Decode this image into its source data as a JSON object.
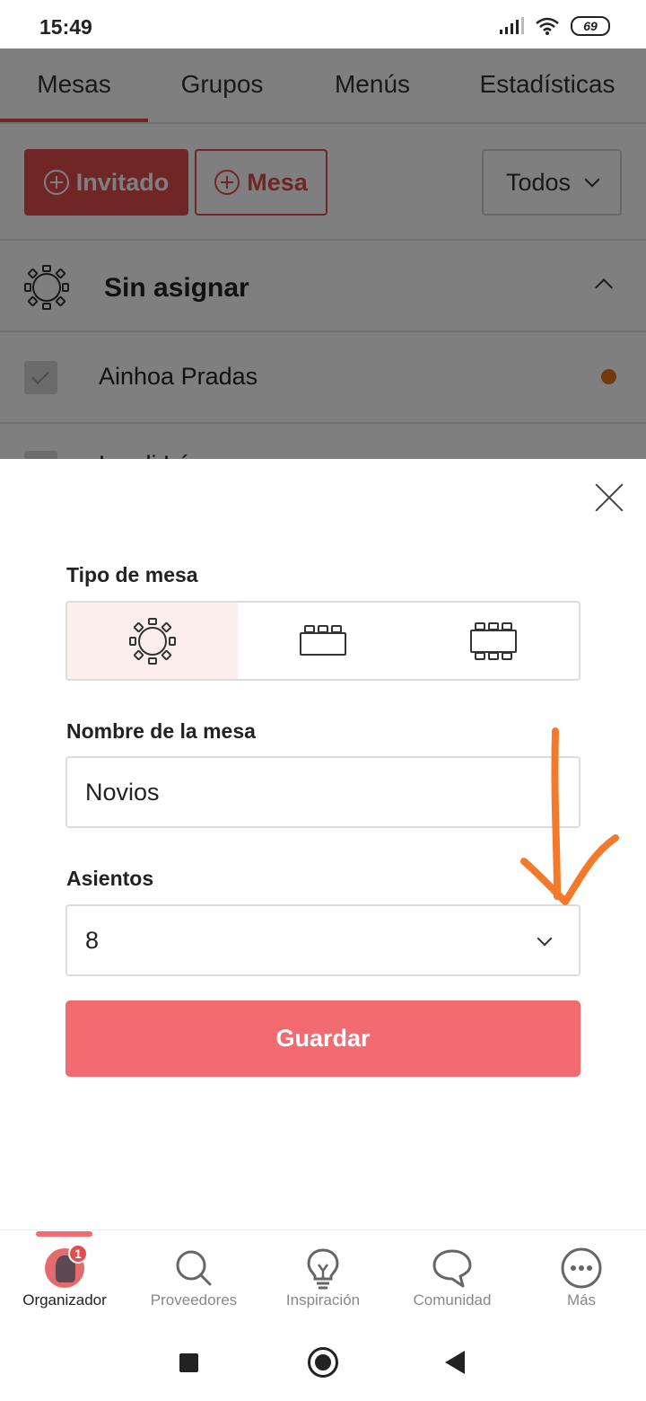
{
  "status_bar": {
    "time": "15:49",
    "battery": "69"
  },
  "tabs": [
    {
      "label": "Mesas",
      "active": true
    },
    {
      "label": "Grupos"
    },
    {
      "label": "Menús"
    },
    {
      "label": "Estadísticas"
    }
  ],
  "actions": {
    "invitado_label": "Invitado",
    "mesa_label": "Mesa",
    "filter_value": "Todos"
  },
  "group": {
    "title": "Sin asignar"
  },
  "guests": [
    {
      "name": "Ainhoa Pradas"
    },
    {
      "name": "Laydi Lé..."
    }
  ],
  "modal": {
    "table_type_label": "Tipo de mesa",
    "table_types": [
      "round-table",
      "rectangular-table",
      "imperial-table"
    ],
    "name_label": "Nombre de la mesa",
    "name_value": "Novios",
    "seats_label": "Asientos",
    "seats_value": "8",
    "save_label": "Guardar"
  },
  "bottom_nav": [
    {
      "label": "Organizador",
      "active": true,
      "badge": "1"
    },
    {
      "label": "Proveedores"
    },
    {
      "label": "Inspiración"
    },
    {
      "label": "Comunidad"
    },
    {
      "label": "Más"
    }
  ],
  "colors": {
    "accent": "#e24d4d",
    "save_button": "#f26b70",
    "annotation": "#f47a2a",
    "guest_dot": "#e0751a"
  }
}
